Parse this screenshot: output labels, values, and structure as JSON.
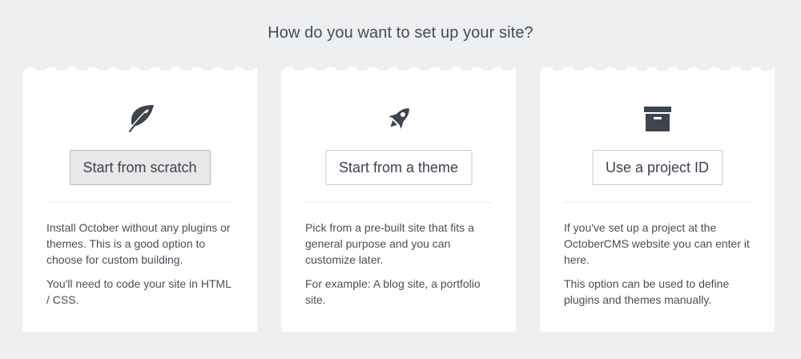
{
  "page": {
    "title": "How do you want to set up your site?"
  },
  "options": [
    {
      "icon": "leaf-icon",
      "button_label": "Start from scratch",
      "selected": true,
      "description": [
        "Install October without any plugins or themes. This is a good option to choose for custom building.",
        "You'll need to code your site in HTML / CSS."
      ]
    },
    {
      "icon": "rocket-icon",
      "button_label": "Start from a theme",
      "selected": false,
      "description": [
        "Pick from a pre-built site that fits a general purpose and you can customize later.",
        "For example: A blog site, a portfolio site."
      ]
    },
    {
      "icon": "archive-box-icon",
      "button_label": "Use a project ID",
      "selected": false,
      "description": [
        "If you've set up a project at the OctoberCMS website you can enter it here.",
        "This option can be used to define plugins and themes manually."
      ]
    }
  ],
  "colors": {
    "background": "#eeeff1",
    "card": "#ffffff",
    "icon": "#3d4550",
    "selected_button": "#e8e8e8"
  }
}
